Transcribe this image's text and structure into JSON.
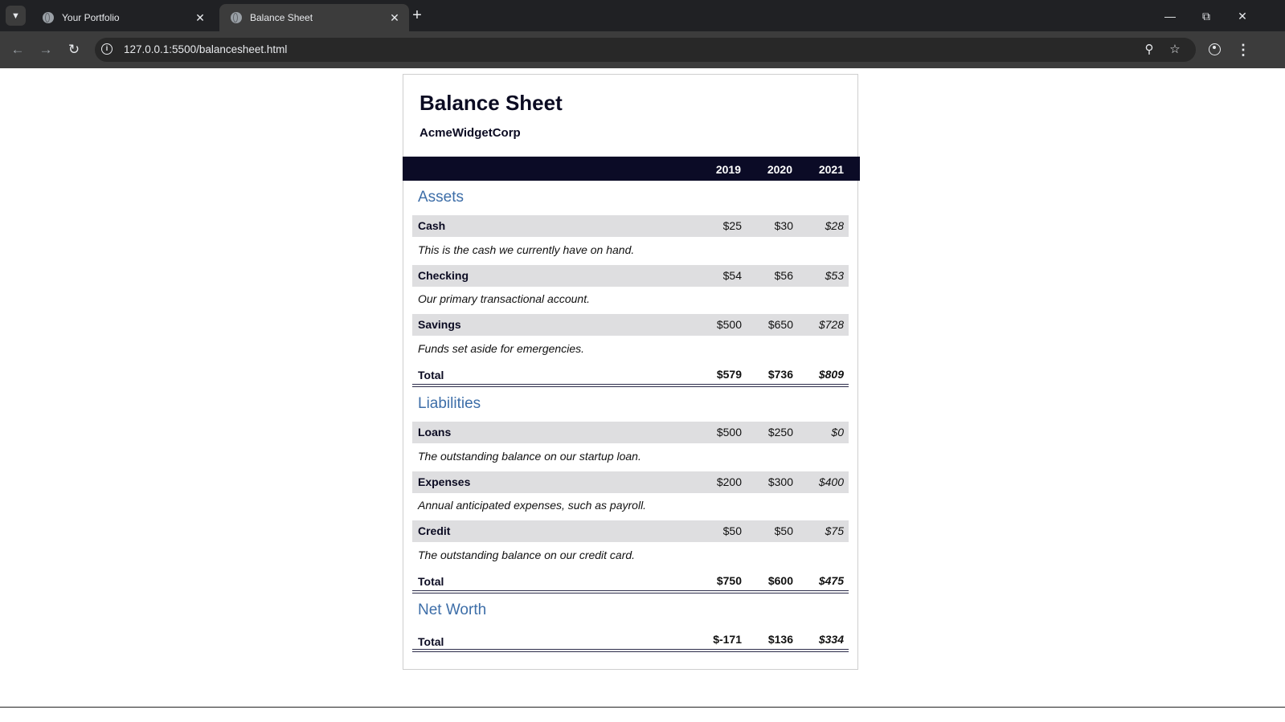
{
  "browser": {
    "tabs": [
      {
        "title": "Your Portfolio",
        "active": false
      },
      {
        "title": "Balance Sheet",
        "active": true
      }
    ],
    "url": "127.0.0.1:5500/balancesheet.html",
    "icons": {
      "tab_search": "chevron-down-icon",
      "new_tab": "plus-icon",
      "back": "arrow-left-icon",
      "forward": "arrow-right-icon",
      "reload": "reload-icon",
      "site_info": "info-icon",
      "zoom": "magnifier-icon",
      "bookmark": "star-icon",
      "profile": "profile-icon",
      "menu": "kebab-menu-icon"
    }
  },
  "page": {
    "title": "Balance Sheet",
    "company": "AcmeWidgetCorp",
    "years": [
      "2019",
      "2020",
      "2021"
    ],
    "accent_color": "#3d6ea8",
    "header_color": "#0b0b26",
    "sections": [
      {
        "title": "Assets",
        "items": [
          {
            "label": "Cash",
            "values": [
              "$25",
              "$30",
              "$28"
            ],
            "description": "This is the cash we currently have on hand."
          },
          {
            "label": "Checking",
            "values": [
              "$54",
              "$56",
              "$53"
            ],
            "description": "Our primary transactional account."
          },
          {
            "label": "Savings",
            "values": [
              "$500",
              "$650",
              "$728"
            ],
            "description": "Funds set aside for emergencies."
          }
        ],
        "total": {
          "label": "Total",
          "values": [
            "$579",
            "$736",
            "$809"
          ]
        }
      },
      {
        "title": "Liabilities",
        "items": [
          {
            "label": "Loans",
            "values": [
              "$500",
              "$250",
              "$0"
            ],
            "description": "The outstanding balance on our startup loan."
          },
          {
            "label": "Expenses",
            "values": [
              "$200",
              "$300",
              "$400"
            ],
            "description": "Annual anticipated expenses, such as payroll."
          },
          {
            "label": "Credit",
            "values": [
              "$50",
              "$50",
              "$75"
            ],
            "description": "The outstanding balance on our credit card."
          }
        ],
        "total": {
          "label": "Total",
          "values": [
            "$750",
            "$600",
            "$475"
          ]
        }
      },
      {
        "title": "Net Worth",
        "items": [],
        "total": {
          "label": "Total",
          "values": [
            "$-171",
            "$136",
            "$334"
          ]
        }
      }
    ]
  }
}
